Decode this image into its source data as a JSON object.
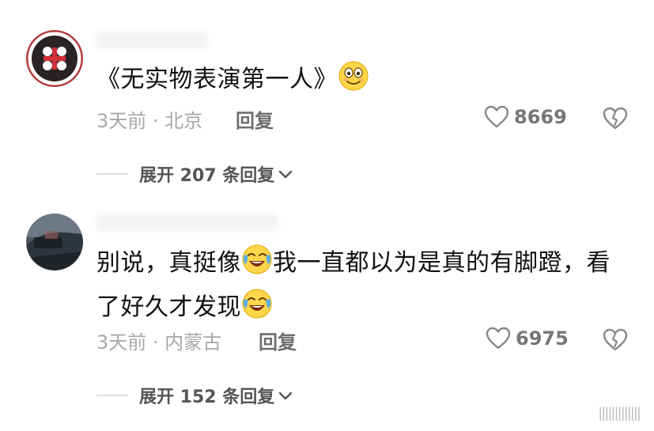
{
  "comments": [
    {
      "text_before_emoji": "《无实物表演第一人》",
      "time_location": "3天前 · 北京",
      "reply_label": "回复",
      "likes": "8669",
      "expand_label": "展开 207 条回复",
      "emoji": "grinning-face-icon"
    },
    {
      "text_part1": "别说，真挺像",
      "text_part2": "我一直都以为是真的有脚蹬，看",
      "text_part3": "了好久才发现",
      "time_location": "3天前 · 内蒙古",
      "reply_label": "回复",
      "likes": "6975",
      "expand_label": "展开 152 条回复",
      "emoji": "laughing-crying-face-icon"
    }
  ],
  "colors": {
    "meta_gray": "#a8a8a8",
    "reply_gray": "#6e6e6e",
    "divider": "#dddddd"
  }
}
